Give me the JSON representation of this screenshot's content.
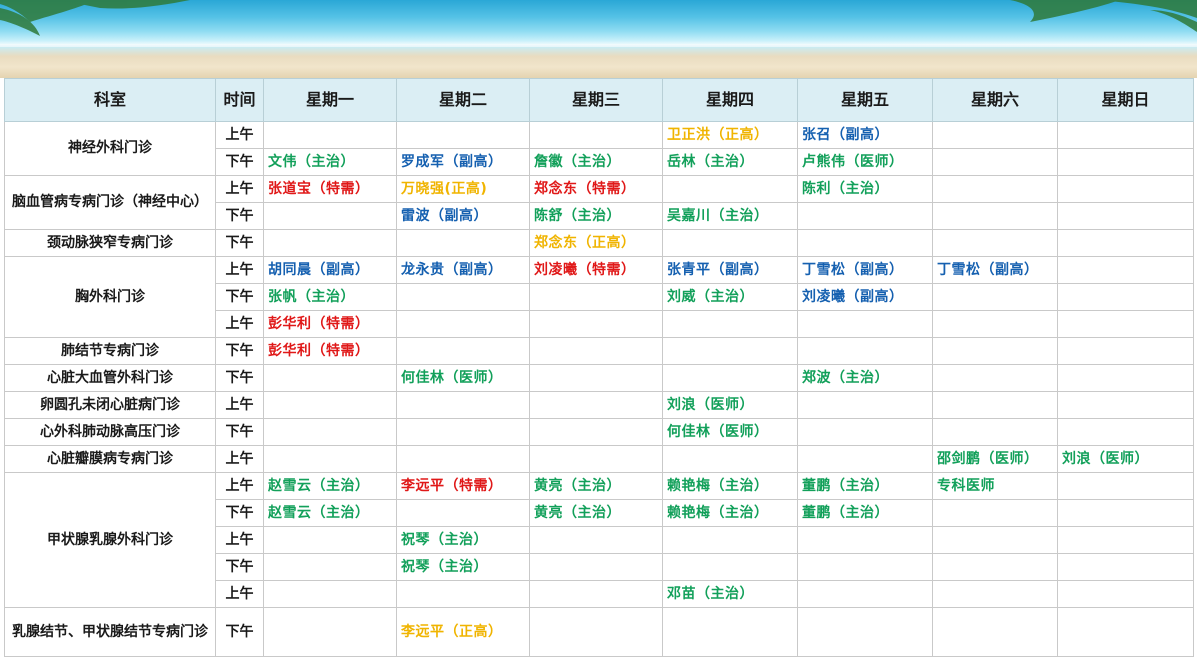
{
  "headers": [
    "科室",
    "时间",
    "星期一",
    "星期二",
    "星期三",
    "星期四",
    "星期五",
    "星期六",
    "星期日"
  ],
  "departments": [
    {
      "name": "神经外科门诊",
      "rows": [
        {
          "time": "上午",
          "cells": [
            "",
            "",
            "",
            {
              "t": "卫正洪（正高）",
              "c": "gold"
            },
            {
              "t": "张召（副高）",
              "c": "blue"
            },
            "",
            ""
          ]
        },
        {
          "time": "下午",
          "cells": [
            {
              "t": "文伟（主治）",
              "c": "green"
            },
            {
              "t": "罗成军（副高）",
              "c": "blue"
            },
            {
              "t": "詹徽（主治）",
              "c": "green"
            },
            {
              "t": "岳林（主治）",
              "c": "green"
            },
            {
              "t": "卢熊伟（医师）",
              "c": "green"
            },
            "",
            ""
          ]
        }
      ]
    },
    {
      "name": "脑血管病专病门诊（神经中心）",
      "rows": [
        {
          "time": "上午",
          "cells": [
            {
              "t": "张道宝（特需）",
              "c": "red"
            },
            {
              "t": "万晓强(正高)",
              "c": "gold"
            },
            {
              "t": "郑念东（特需）",
              "c": "red"
            },
            "",
            {
              "t": "陈利（主治）",
              "c": "green"
            },
            "",
            ""
          ]
        },
        {
          "time": "下午",
          "cells": [
            "",
            {
              "t": "雷波（副高）",
              "c": "blue"
            },
            {
              "t": "陈舒（主治）",
              "c": "green"
            },
            {
              "t": "吴嘉川（主治）",
              "c": "green"
            },
            "",
            "",
            ""
          ]
        }
      ]
    },
    {
      "name": "颈动脉狭窄专病门诊",
      "rows": [
        {
          "time": "下午",
          "cells": [
            "",
            "",
            {
              "t": "郑念东（正高）",
              "c": "gold"
            },
            "",
            "",
            "",
            ""
          ]
        }
      ]
    },
    {
      "name": "胸外科门诊",
      "rows": [
        {
          "time": "上午",
          "cells": [
            {
              "t": "胡同晨（副高）",
              "c": "blue"
            },
            {
              "t": "龙永贵（副高）",
              "c": "blue"
            },
            {
              "t": "刘凌曦（特需）",
              "c": "red"
            },
            {
              "t": "张青平（副高）",
              "c": "blue"
            },
            {
              "t": "丁雪松（副高）",
              "c": "blue"
            },
            {
              "t": "丁雪松（副高）",
              "c": "blue"
            },
            ""
          ]
        },
        {
          "time": "下午",
          "cells": [
            {
              "t": "张帆（主治）",
              "c": "green"
            },
            "",
            "",
            {
              "t": "刘威（主治）",
              "c": "green"
            },
            {
              "t": "刘凌曦（副高）",
              "c": "blue"
            },
            "",
            ""
          ]
        },
        {
          "time": "上午",
          "cells": [
            {
              "t": "彭华利（特需）",
              "c": "red"
            },
            "",
            "",
            "",
            "",
            "",
            ""
          ]
        }
      ]
    },
    {
      "name": "肺结节专病门诊",
      "rows": [
        {
          "time": "下午",
          "cells": [
            {
              "t": "彭华利（特需）",
              "c": "red"
            },
            "",
            "",
            "",
            "",
            "",
            ""
          ]
        }
      ]
    },
    {
      "name": "心脏大血管外科门诊",
      "rows": [
        {
          "time": "下午",
          "cells": [
            "",
            {
              "t": "何佳林（医师）",
              "c": "green"
            },
            "",
            "",
            {
              "t": "郑波（主治）",
              "c": "green"
            },
            "",
            ""
          ]
        }
      ]
    },
    {
      "name": "卵圆孔未闭心脏病门诊",
      "rows": [
        {
          "time": "上午",
          "cells": [
            "",
            "",
            "",
            {
              "t": "刘浪（医师）",
              "c": "green"
            },
            "",
            "",
            ""
          ]
        }
      ]
    },
    {
      "name": "心外科肺动脉高压门诊",
      "rows": [
        {
          "time": "下午",
          "cells": [
            "",
            "",
            "",
            {
              "t": "何佳林（医师）",
              "c": "green"
            },
            "",
            "",
            ""
          ]
        }
      ]
    },
    {
      "name": "心脏瓣膜病专病门诊",
      "rows": [
        {
          "time": "上午",
          "cells": [
            "",
            "",
            "",
            "",
            "",
            {
              "t": "邵剑鹏（医师）",
              "c": "green"
            },
            {
              "t": "刘浪（医师）",
              "c": "green"
            }
          ]
        }
      ]
    },
    {
      "name": "甲状腺乳腺外科门诊",
      "rows": [
        {
          "time": "上午",
          "cells": [
            {
              "t": "赵雪云（主治）",
              "c": "green"
            },
            {
              "t": "李远平（特需）",
              "c": "red"
            },
            {
              "t": "黄亮（主治）",
              "c": "green"
            },
            {
              "t": "赖艳梅（主治）",
              "c": "green"
            },
            {
              "t": "董鹏（主治）",
              "c": "green"
            },
            {
              "t": "专科医师",
              "c": "green"
            },
            ""
          ]
        },
        {
          "time": "下午",
          "cells": [
            {
              "t": "赵雪云（主治）",
              "c": "green"
            },
            "",
            {
              "t": "黄亮（主治）",
              "c": "green"
            },
            {
              "t": "赖艳梅（主治）",
              "c": "green"
            },
            {
              "t": "董鹏（主治）",
              "c": "green"
            },
            "",
            ""
          ]
        },
        {
          "time": "上午",
          "cells": [
            "",
            {
              "t": "祝琴（主治）",
              "c": "green"
            },
            "",
            "",
            "",
            "",
            ""
          ]
        },
        {
          "time": "下午",
          "cells": [
            "",
            {
              "t": "祝琴（主治）",
              "c": "green"
            },
            "",
            "",
            "",
            "",
            ""
          ]
        },
        {
          "time": "上午",
          "cells": [
            "",
            "",
            "",
            {
              "t": "邓苗（主治）",
              "c": "green"
            },
            "",
            "",
            ""
          ]
        }
      ]
    },
    {
      "name": "乳腺结节、甲状腺结节专病门诊",
      "rows": [
        {
          "time": "下午",
          "cells": [
            "",
            {
              "t": "李远平（正高）",
              "c": "gold"
            },
            "",
            "",
            "",
            "",
            ""
          ]
        }
      ]
    }
  ],
  "colors": {
    "blue": "#1560b0",
    "green": "#12a05a",
    "red": "#e01818",
    "gold": "#f0b400",
    "header_bg": "#dbeef4"
  }
}
